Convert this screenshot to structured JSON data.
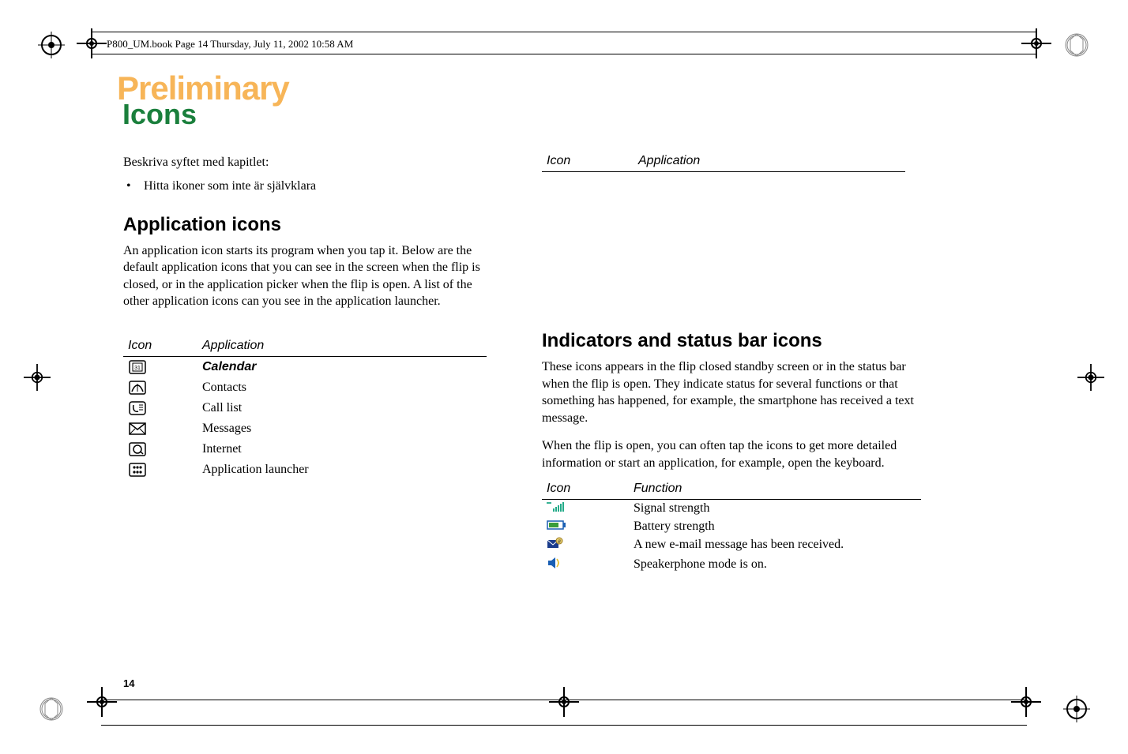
{
  "header": {
    "text": "P800_UM.book  Page 14  Thursday, July 11, 2002  10:58 AM"
  },
  "watermark": "Preliminary",
  "section_title": "Icons",
  "intro": {
    "line1": "Beskriva syftet med kapitlet:",
    "bullet": "Hitta ikoner som inte är självklara"
  },
  "app_icons": {
    "heading": "Application icons",
    "paragraph": "An application icon starts its program when you tap it. Below are the default application icons that you can see in the screen when the flip is closed, or in the application picker when the flip is open. A list of the other application icons can you see in the application launcher.",
    "table": {
      "header_icon": "Icon",
      "header_app": "Application",
      "rows": [
        {
          "icon": "calendar-icon",
          "label": "Calendar",
          "bold": true
        },
        {
          "icon": "contacts-icon",
          "label": "Contacts",
          "bold": false
        },
        {
          "icon": "calllist-icon",
          "label": "Call list",
          "bold": false
        },
        {
          "icon": "messages-icon",
          "label": "Messages",
          "bold": false
        },
        {
          "icon": "internet-icon",
          "label": "Internet",
          "bold": false
        },
        {
          "icon": "launcher-icon",
          "label": "Application launcher",
          "bold": false
        }
      ]
    }
  },
  "indicators": {
    "heading": "Indicators and status bar icons",
    "paragraph1": "These icons appears in the flip closed standby screen or in the status bar when the flip is open. They indicate status for several functions or that something has happened, for example, the smartphone has received a text message.",
    "paragraph2": "When the flip is open, you can often tap the icons to get more detailed information or start an application, for example, open the keyboard.",
    "right_top_header_icon": "Icon",
    "right_top_header_app": "Application",
    "table": {
      "header_icon": "Icon",
      "header_func": "Function",
      "rows": [
        {
          "icon": "signal-icon",
          "label": "Signal strength"
        },
        {
          "icon": "battery-icon",
          "label": "Battery strength"
        },
        {
          "icon": "email-icon",
          "label": "A new e-mail message has been received."
        },
        {
          "icon": "speaker-icon",
          "label": "Speakerphone mode is on."
        }
      ]
    }
  },
  "page_number": "14"
}
